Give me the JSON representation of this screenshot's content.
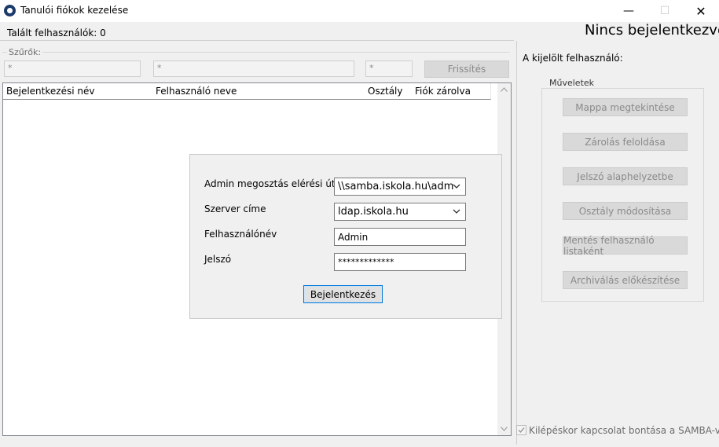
{
  "window": {
    "title": "Tanulói fiókok kezelése",
    "minimize": "—",
    "maximize": "☐",
    "close": "✕"
  },
  "header": {
    "found_users": "Talált felhasználók: 0",
    "status": "Nincs bejelentkezve"
  },
  "filters": {
    "legend": "Szűrők:",
    "login_filter": "*",
    "name_filter": "*",
    "class_filter": "*",
    "refresh_label": "Frissítés"
  },
  "table": {
    "columns": [
      "Bejelentkezési név",
      "Felhasználó neve",
      "Osztály",
      "Fiók zárolva"
    ],
    "rows": []
  },
  "login_dialog": {
    "share_label": "Admin megosztás elérési útja",
    "share_value": "\\\\samba.iskola.hu\\adm",
    "server_label": "Szerver címe",
    "server_value": "ldap.iskola.hu",
    "username_label": "Felhasználónév",
    "username_value": "Admin",
    "password_label": "Jelszó",
    "password_value": "*************",
    "login_button": "Bejelentkezés"
  },
  "right_panel": {
    "selected_user_label": "A kijelölt felhasználó:",
    "operations_legend": "Műveletek",
    "operations": [
      "Mappa megtekintése",
      "Zárolás feloldása",
      "Jelszó alaphelyzetbe",
      "Osztály módosítása",
      "Mentés felhasználó listaként",
      "Archiválás előkészítése"
    ],
    "disconnect_checkbox": "Kilépéskor kapcsolat bontása a SAMBA-val",
    "disconnect_checked": true
  },
  "icons": {
    "app": "paw-icon",
    "dropdown": "chevron-down-icon"
  }
}
